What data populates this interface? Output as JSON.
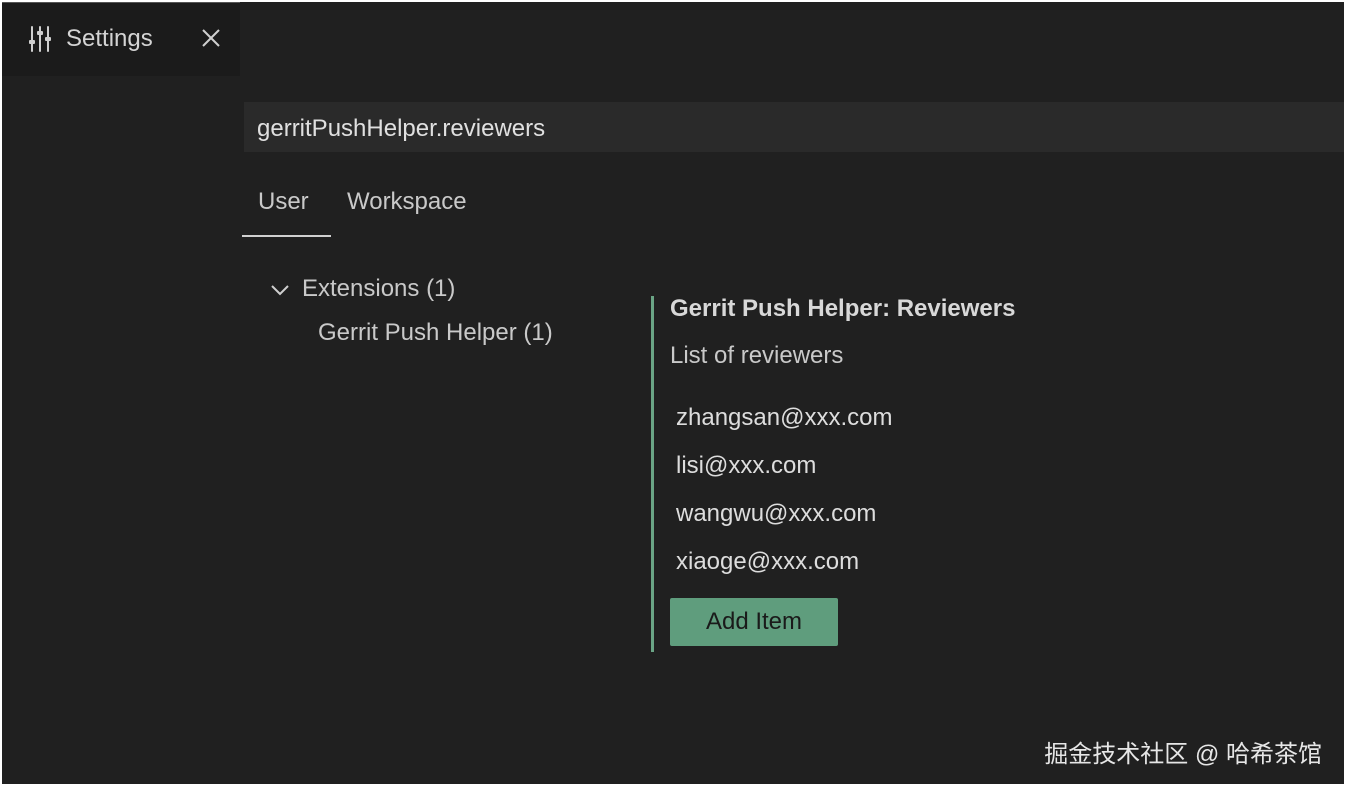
{
  "tab": {
    "icon": "settings-sliders-icon",
    "title": "Settings",
    "close_icon": "close-icon"
  },
  "search": {
    "value": "gerritPushHelper.reviewers"
  },
  "scope_tabs": [
    {
      "label": "User",
      "active": true
    },
    {
      "label": "Workspace",
      "active": false
    }
  ],
  "toc": {
    "group_label": "Extensions (1)",
    "group_expanded": true,
    "items": [
      {
        "label": "Gerrit Push Helper (1)"
      }
    ]
  },
  "setting": {
    "title": "Gerrit Push Helper: Reviewers",
    "description": "List of reviewers",
    "items": [
      "zhangsan@xxx.com",
      "lisi@xxx.com",
      "wangwu@xxx.com",
      "xiaoge@xxx.com"
    ],
    "add_button_label": "Add Item",
    "accent_color": "#6aa485"
  },
  "watermark": "掘金技术社区 @ 哈希茶馆"
}
